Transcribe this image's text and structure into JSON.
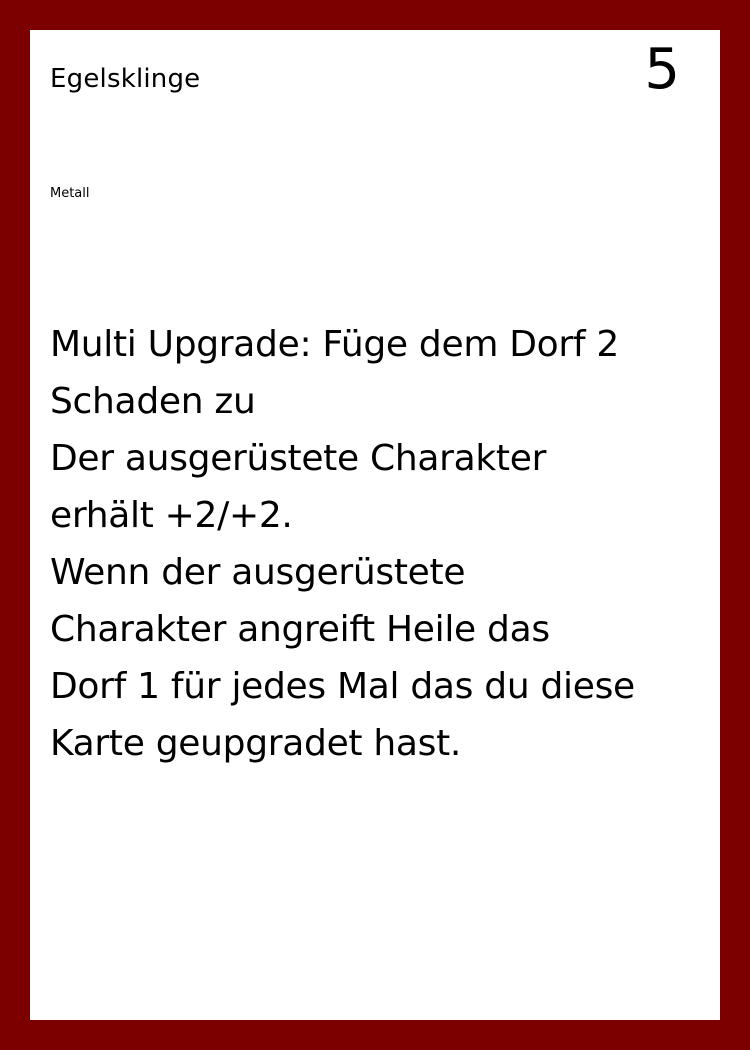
{
  "card": {
    "name": "Egelsklinge",
    "cost": "5",
    "type": "Metall",
    "text_lines": [
      "Multi Upgrade: Füge dem Dorf 2",
      "Schaden zu",
      "Der ausgerüstete Charakter",
      "erhält +2/+2.",
      "Wenn der ausgerüstete",
      "Charakter angreift Heile das",
      "Dorf 1 für jedes Mal das du diese",
      "Karte geupgradet hast."
    ]
  },
  "colors": {
    "frame": "#7d0000",
    "card_background": "#ffffff",
    "text": "#000000"
  }
}
